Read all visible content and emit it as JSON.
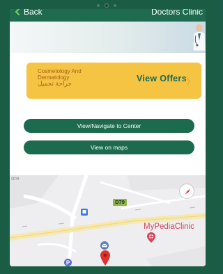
{
  "header": {
    "back_label": "Back",
    "title": "Doctors Clinic"
  },
  "offer_card": {
    "category_en": "Cosmetology And Dermatology",
    "category_ar": "جراحة تجميل",
    "cta_label": "View Offers",
    "arrow_icon": "chevron-right-icon"
  },
  "actions": {
    "navigate_label": "View/Navigate to Center",
    "maps_label": "View on maps"
  },
  "map": {
    "more_label": "ore",
    "road_tag": "D79",
    "poi_label": "MyPediaClinic"
  },
  "colors": {
    "brand_green": "#1d6b4e",
    "offer_yellow": "#f6c443",
    "poi_red": "#d4445b"
  }
}
